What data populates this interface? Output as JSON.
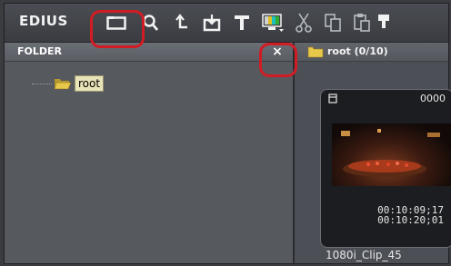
{
  "app": {
    "name": "EDIUS"
  },
  "toolbar": {
    "tools": [
      {
        "name": "new-folder"
      },
      {
        "name": "search"
      },
      {
        "name": "up-one-level"
      },
      {
        "name": "open-clip"
      },
      {
        "name": "add-title"
      },
      {
        "name": "color-bar"
      },
      {
        "name": "cut"
      },
      {
        "name": "copy"
      },
      {
        "name": "paste"
      },
      {
        "name": "add-to-timeline"
      }
    ]
  },
  "folder_panel": {
    "title": "FOLDER",
    "close_glyph": "×",
    "tree": [
      {
        "label": "root"
      }
    ]
  },
  "bin": {
    "path_label": "root (0/10)",
    "clips": [
      {
        "number": "0000",
        "timecode_in": "00:10:09;17",
        "timecode_out": "00:10:20;01",
        "name": "1080i_Clip_45"
      }
    ]
  },
  "colors": {
    "highlight": "#d21c24",
    "folder_icon": "#e8c84a",
    "selected_item_bg": "#e8e3b8"
  }
}
